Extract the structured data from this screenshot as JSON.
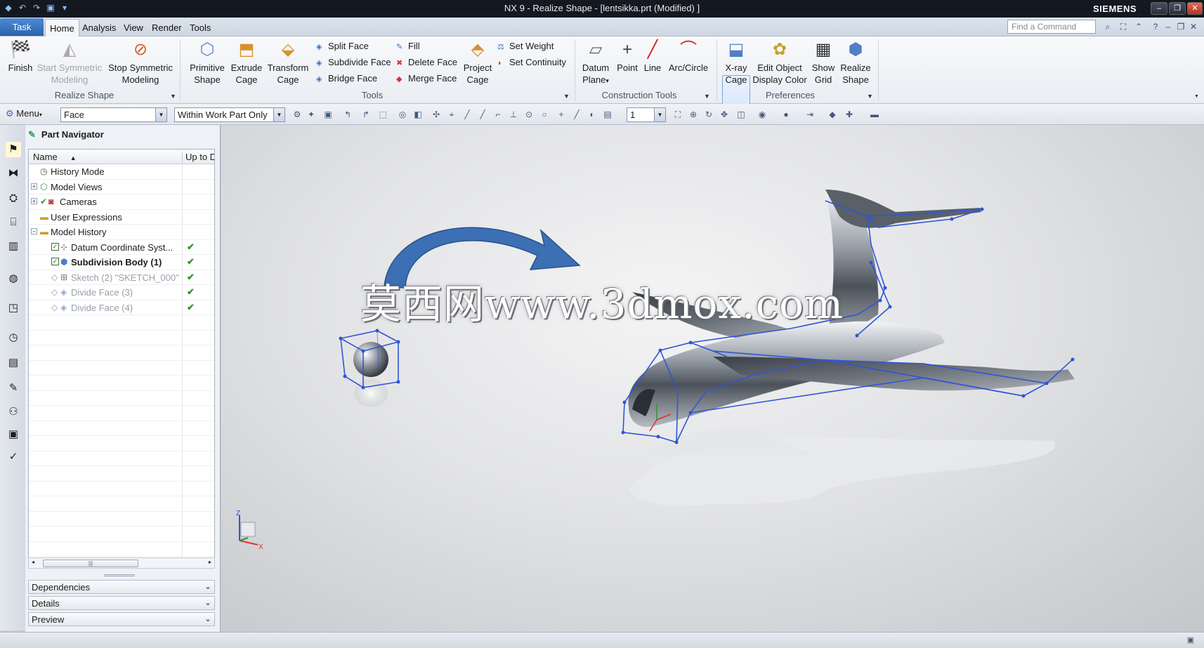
{
  "window": {
    "title": "NX 9 - Realize Shape - [lentsikka.prt (Modified) ]",
    "brand": "SIEMENS",
    "accent": "#2a62ae"
  },
  "menu_tabs": [
    "Task",
    "Home",
    "Analysis",
    "View",
    "Render",
    "Tools"
  ],
  "find_command_placeholder": "Find a Command",
  "ribbon": {
    "realize_shape_group": {
      "label": "Realize Shape",
      "finish": "Finish",
      "start_symmetric_1": "Start Symmetric",
      "start_symmetric_2": "Modeling",
      "stop_symmetric_1": "Stop Symmetric",
      "stop_symmetric_2": "Modeling"
    },
    "tools_group": {
      "label": "Tools",
      "primitive_1": "Primitive",
      "primitive_2": "Shape",
      "extrude_1": "Extrude",
      "extrude_2": "Cage",
      "transform_1": "Transform",
      "transform_2": "Cage",
      "split_face": "Split Face",
      "subdivide_face": "Subdivide Face",
      "bridge_face": "Bridge Face",
      "fill": "Fill",
      "delete_face": "Delete Face",
      "merge_face": "Merge Face",
      "project_1": "Project",
      "project_2": "Cage",
      "set_weight": "Set Weight",
      "set_continuity": "Set Continuity"
    },
    "construction_group": {
      "label": "Construction Tools",
      "datum_1": "Datum",
      "datum_2": "Plane",
      "point": "Point",
      "line": "Line",
      "arc_circle": "Arc/Circle"
    },
    "preferences_group": {
      "label": "Preferences",
      "xray_1": "X-ray",
      "xray_2": "Cage",
      "edit_color_1": "Edit Object",
      "edit_color_2": "Display Color",
      "show_grid_1": "Show",
      "show_grid_2": "Grid",
      "realize_1": "Realize",
      "realize_2": "Shape"
    }
  },
  "toolbar": {
    "menu_label": "Menu",
    "filter_value": "Face",
    "scope_value": "Within Work Part Only",
    "count_value": "1"
  },
  "navigator": {
    "title": "Part Navigator",
    "col_name": "Name",
    "col_upto": "Up to Date",
    "rows": [
      {
        "label": "History Mode",
        "up_to_date": ""
      },
      {
        "label": "Model Views",
        "up_to_date": ""
      },
      {
        "label": "Cameras",
        "up_to_date": ""
      },
      {
        "label": "User Expressions",
        "up_to_date": ""
      },
      {
        "label": "Model History",
        "up_to_date": ""
      },
      {
        "label": "Datum Coordinate Syst...",
        "up_to_date": "✔"
      },
      {
        "label": "Subdivision Body (1)",
        "up_to_date": "✔"
      },
      {
        "label": "Sketch (2) \"SKETCH_000\"",
        "up_to_date": "✔"
      },
      {
        "label": "Divide Face (3)",
        "up_to_date": "✔"
      },
      {
        "label": "Divide Face (4)",
        "up_to_date": "✔"
      }
    ],
    "panels": [
      "Dependencies",
      "Details",
      "Preview"
    ]
  },
  "viewport": {
    "watermark": "莫西网www.3dmox.com",
    "axis_labels": {
      "z": "Z",
      "x": "X"
    },
    "cage_color": "#2f55d4",
    "arrow_color": "#3c6fb4"
  }
}
